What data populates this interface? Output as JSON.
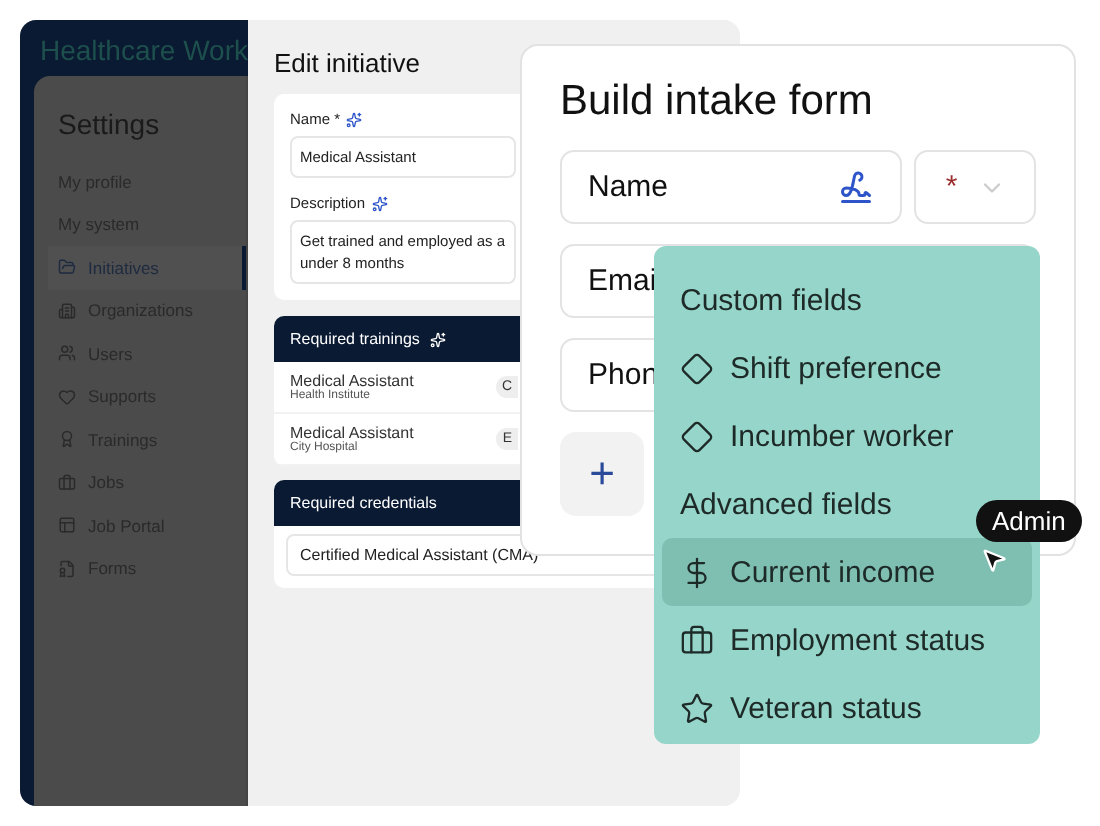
{
  "app": {
    "title": "Healthcare Work"
  },
  "sidebar": {
    "title": "Settings",
    "items": [
      {
        "label": "My profile",
        "selected": false
      },
      {
        "label": "My system",
        "selected": false
      },
      {
        "label": "Initiatives",
        "selected": true
      },
      {
        "label": "Organizations",
        "selected": false
      },
      {
        "label": "Users",
        "selected": false
      },
      {
        "label": "Supports",
        "selected": false
      },
      {
        "label": "Trainings",
        "selected": false
      },
      {
        "label": "Jobs",
        "selected": false
      },
      {
        "label": "Job Portal",
        "selected": false
      },
      {
        "label": "Forms",
        "selected": false
      }
    ]
  },
  "edit_initiative": {
    "title": "Edit initiative",
    "name_label": "Name *",
    "name_value": "Medical Assistant",
    "description_label": "Description",
    "description_lines": [
      "Get trained and employed as a",
      "under 8 months"
    ],
    "trainings": {
      "title": "Required trainings",
      "rows": [
        {
          "name": "Medical Assistant",
          "provider": "Health Institute",
          "tag": "C"
        },
        {
          "name": "Medical Assistant",
          "provider": "City Hospital",
          "tag": "E"
        }
      ]
    },
    "credentials": {
      "title": "Required credentials",
      "items": [
        "Certified Medical Assistant (CMA)"
      ]
    }
  },
  "intake_form": {
    "title": "Build intake form",
    "fields": [
      {
        "label": "Name"
      },
      {
        "label": "Emai"
      },
      {
        "label": "Phon"
      }
    ],
    "required_marker": "*",
    "add_button": "+"
  },
  "field_menu": {
    "sections": [
      {
        "title": "Custom fields",
        "items": [
          {
            "label": "Shift preference",
            "kind": "diamond",
            "selected": false
          },
          {
            "label": "Incumber worker",
            "kind": "diamond",
            "selected": false
          }
        ]
      },
      {
        "title": "Advanced fields",
        "items": [
          {
            "label": "Current income",
            "kind": "dollar",
            "selected": true
          },
          {
            "label": "Employment status",
            "kind": "briefcase",
            "selected": false
          },
          {
            "label": "Veteran status",
            "kind": "star",
            "selected": false
          }
        ]
      }
    ]
  },
  "tooltip": {
    "label": "Admin"
  }
}
